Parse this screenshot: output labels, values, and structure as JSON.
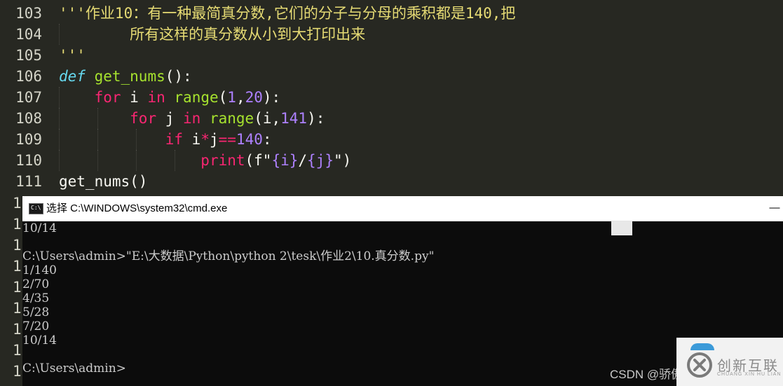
{
  "editor": {
    "lines": [
      {
        "num": "103",
        "parts": [
          [
            "s",
            "'''作业10：有一种最简真分数,它们的分子与分母的乘积都是140,把"
          ]
        ]
      },
      {
        "num": "104",
        "parts": [
          [
            "s",
            "        所有这样的真分数从小到大打印出来"
          ]
        ]
      },
      {
        "num": "105",
        "parts": [
          [
            "s",
            "'''"
          ]
        ]
      },
      {
        "num": "106",
        "parts": [
          [
            "def",
            "def"
          ],
          [
            "p",
            " "
          ],
          [
            "fn",
            "get_nums"
          ],
          [
            "p",
            "():"
          ]
        ]
      },
      {
        "num": "107",
        "parts": [
          [
            "p",
            "    "
          ],
          [
            "kw",
            "for"
          ],
          [
            "p",
            " i "
          ],
          [
            "kw",
            "in"
          ],
          [
            "p",
            " "
          ],
          [
            "fn",
            "range"
          ],
          [
            "p",
            "("
          ],
          [
            "num",
            "1"
          ],
          [
            "p",
            ","
          ],
          [
            "num",
            "20"
          ],
          [
            "p",
            "):"
          ]
        ]
      },
      {
        "num": "108",
        "parts": [
          [
            "p",
            "        "
          ],
          [
            "kw",
            "for"
          ],
          [
            "p",
            " j "
          ],
          [
            "kw",
            "in"
          ],
          [
            "p",
            " "
          ],
          [
            "fn",
            "range"
          ],
          [
            "p",
            "(i,"
          ],
          [
            "num",
            "141"
          ],
          [
            "p",
            "):"
          ]
        ]
      },
      {
        "num": "109",
        "parts": [
          [
            "p",
            "            "
          ],
          [
            "kw",
            "if"
          ],
          [
            "p",
            " i"
          ],
          [
            "op",
            "*"
          ],
          [
            "p",
            "j"
          ],
          [
            "op",
            "=="
          ],
          [
            "num",
            "140"
          ],
          [
            "p",
            ":"
          ]
        ]
      },
      {
        "num": "110",
        "parts": [
          [
            "p",
            "                "
          ],
          [
            "bi",
            "print"
          ],
          [
            "p",
            "(f\""
          ],
          [
            "num",
            "{i}"
          ],
          [
            "p",
            "/"
          ],
          [
            "num",
            "{j}"
          ],
          [
            "p",
            "\")"
          ]
        ]
      },
      {
        "num": "111",
        "parts": [
          [
            "p",
            "get_nums()"
          ]
        ]
      }
    ],
    "partial_line_numbers": [
      "1",
      "1",
      "1",
      "1",
      "1",
      "1",
      "1",
      "1",
      "1"
    ]
  },
  "cmd": {
    "title": "选择 C:\\WINDOWS\\system32\\cmd.exe",
    "minimize_glyph": "—",
    "icon_text": "C:\\",
    "output_lines": [
      "10/14",
      "",
      "C:\\Users\\admin>\"E:\\大数据\\Python\\python 2\\tesk\\作业2\\10.真分数.py\"",
      "1/140",
      "2/70",
      "4/35",
      "5/28",
      "7/20",
      "10/14",
      "",
      "C:\\Users\\admin>"
    ]
  },
  "overlay": {
    "csdn_text": "CSDN @骄傲",
    "watermark_text": "创新互联",
    "watermark_sub": "CHUANG XIN HU LIAN"
  },
  "colors": {
    "editor_bg": "#272822",
    "string": "#e6db74",
    "keyword": "#f92672",
    "function": "#a6e22e",
    "number": "#ae81ff",
    "def": "#66d9ef",
    "terminal_bg": "#0c0c0c",
    "terminal_fg": "#cccccc"
  }
}
